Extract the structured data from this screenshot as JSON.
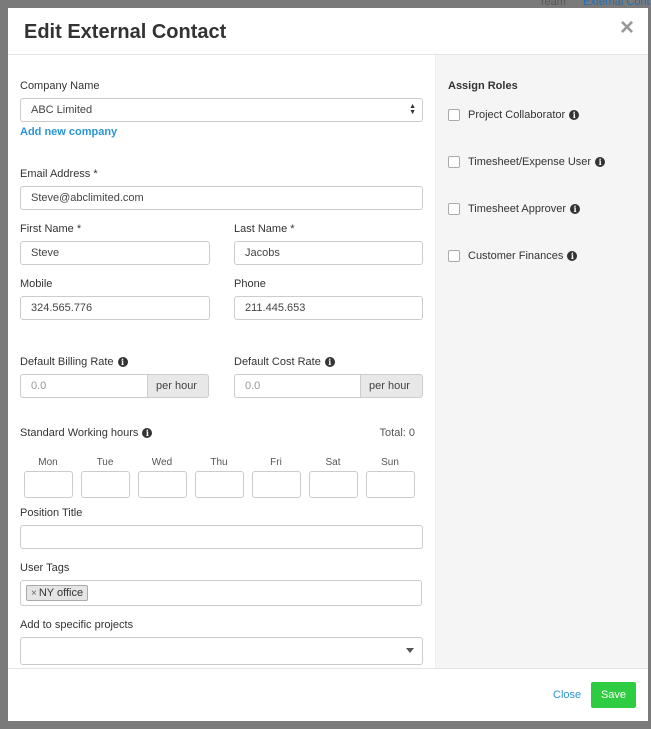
{
  "background": {
    "tab1": "Team",
    "tab2": "External Cont"
  },
  "modal": {
    "title": "Edit External Contact",
    "close_glyph": "×"
  },
  "form": {
    "company": {
      "label": "Company Name",
      "value": "ABC Limited",
      "add_link": "Add new company"
    },
    "email": {
      "label": "Email Address *",
      "value": "Steve@abclimited.com"
    },
    "first_name": {
      "label": "First Name *",
      "value": "Steve"
    },
    "last_name": {
      "label": "Last Name *",
      "value": "Jacobs"
    },
    "mobile": {
      "label": "Mobile",
      "value": "324.565.776"
    },
    "phone": {
      "label": "Phone",
      "value": "211.445.653"
    },
    "billing_rate": {
      "label": "Default Billing Rate",
      "placeholder": "0.0",
      "addon": "per hour"
    },
    "cost_rate": {
      "label": "Default Cost Rate",
      "placeholder": "0.0",
      "addon": "per hour"
    },
    "working_hours": {
      "label": "Standard Working hours",
      "total": "Total: 0",
      "days": [
        "Mon",
        "Tue",
        "Wed",
        "Thu",
        "Fri",
        "Sat",
        "Sun"
      ]
    },
    "position_title": {
      "label": "Position Title",
      "value": ""
    },
    "user_tags": {
      "label": "User Tags",
      "tags": [
        "NY office"
      ]
    },
    "projects": {
      "label": "Add to specific projects",
      "value": ""
    }
  },
  "roles": {
    "heading": "Assign Roles",
    "items": [
      {
        "label": "Project Collaborator",
        "checked": false
      },
      {
        "label": "Timesheet/Expense User",
        "checked": false
      },
      {
        "label": "Timesheet Approver",
        "checked": false
      },
      {
        "label": "Customer Finances",
        "checked": false
      }
    ]
  },
  "footer": {
    "close_label": "Close",
    "save_label": "Save"
  },
  "colors": {
    "link": "#2b96d4",
    "save": "#2ecc40",
    "overlay": "#7a7a7a"
  },
  "icons": {
    "info": "info-circle-icon",
    "close": "close-icon",
    "select": "chevron-updown-icon",
    "dropdown": "caret-down-icon"
  }
}
